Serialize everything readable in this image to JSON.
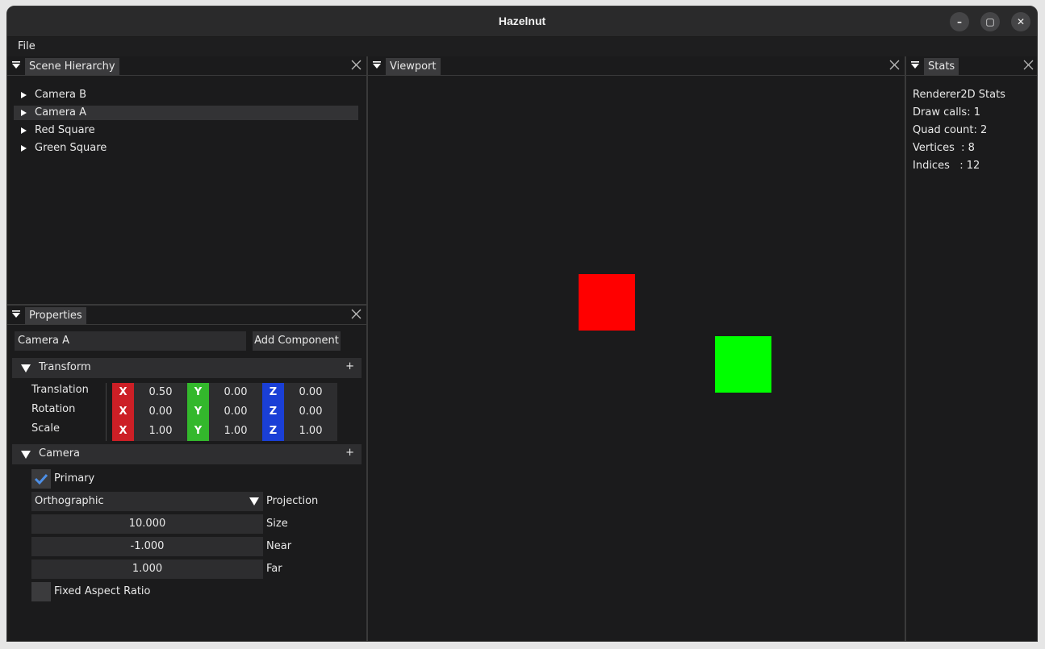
{
  "window": {
    "title": "Hazelnut",
    "controls": [
      "–",
      "▢",
      "✕"
    ]
  },
  "menu": {
    "items": [
      "File"
    ]
  },
  "scene_hierarchy": {
    "tab_label": "Scene Hierarchy",
    "items": [
      {
        "label": "Camera B",
        "selected": false
      },
      {
        "label": "Camera A",
        "selected": true
      },
      {
        "label": "Red Square",
        "selected": false
      },
      {
        "label": "Green Square",
        "selected": false
      }
    ]
  },
  "properties": {
    "tab_label": "Properties",
    "entity_name": "Camera A",
    "add_component_label": "Add Component",
    "transform": {
      "header": "Transform",
      "plus": "+",
      "rows": [
        {
          "label": "Translation",
          "x": "0.50",
          "y": "0.00",
          "z": "0.00"
        },
        {
          "label": "Rotation",
          "x": "0.00",
          "y": "0.00",
          "z": "0.00"
        },
        {
          "label": "Scale",
          "x": "1.00",
          "y": "1.00",
          "z": "1.00"
        }
      ],
      "axis_labels": {
        "x": "X",
        "y": "Y",
        "z": "Z"
      },
      "axis_colors": {
        "x": "#cc1f26",
        "y": "#33b82c",
        "z": "#1a3fd6"
      }
    },
    "camera": {
      "header": "Camera",
      "plus": "+",
      "primary_label": "Primary",
      "primary_checked": true,
      "projection_value": "Orthographic",
      "projection_label": "Projection",
      "size_value": "10.000",
      "size_label": "Size",
      "near_value": "-1.000",
      "near_label": "Near",
      "far_value": "1.000",
      "far_label": "Far",
      "fixed_aspect_label": "Fixed Aspect Ratio",
      "fixed_aspect_checked": false
    }
  },
  "viewport": {
    "tab_label": "Viewport",
    "background": "#1b1b1c",
    "squares": [
      {
        "name": "red-square",
        "color": "#ff0000"
      },
      {
        "name": "green-square",
        "color": "#00ff00"
      }
    ]
  },
  "stats": {
    "tab_label": "Stats",
    "lines": [
      "Renderer2D Stats",
      "Draw calls: 1",
      "Quad count: 2",
      "Vertices  : 8",
      "Indices   : 12"
    ]
  },
  "colors": {
    "accent_check": "#4d8fe6"
  }
}
